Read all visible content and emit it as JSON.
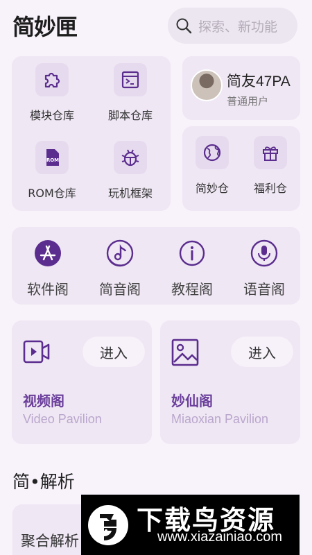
{
  "header": {
    "logo": "简妙匣",
    "search_placeholder": "探索、新功能"
  },
  "grid_left": [
    {
      "label": "模块仓库",
      "icon": "puzzle-icon"
    },
    {
      "label": "脚本仓库",
      "icon": "terminal-icon"
    },
    {
      "label": "ROM仓库",
      "icon": "rom-file-icon"
    },
    {
      "label": "玩机框架",
      "icon": "bug-icon"
    }
  ],
  "profile": {
    "name": "简友47PA",
    "role": "普通用户"
  },
  "grid_right": [
    {
      "label": "简妙仓",
      "icon": "globe-icon"
    },
    {
      "label": "福利仓",
      "icon": "gift-icon"
    }
  ],
  "big_row": [
    {
      "label": "软件阁",
      "icon": "app-store-icon"
    },
    {
      "label": "简音阁",
      "icon": "music-icon"
    },
    {
      "label": "教程阁",
      "icon": "info-icon"
    },
    {
      "label": "语音阁",
      "icon": "microphone-icon"
    }
  ],
  "features": [
    {
      "title": "视频阁",
      "subtitle": "Video Pavilion",
      "enter": "进入",
      "icon": "video-icon"
    },
    {
      "title": "妙仙阁",
      "subtitle": "Miaoxian Pavilion",
      "enter": "进入",
      "icon": "image-icon"
    }
  ],
  "section": {
    "title": "简•解析",
    "card_label": "聚合解析"
  },
  "watermark": {
    "text": "下载鸟资源",
    "url": "www.xiazainiao.com"
  },
  "colors": {
    "accent": "#5b2d8e",
    "background": "#f8f2fb",
    "card": "#efe7f4"
  }
}
